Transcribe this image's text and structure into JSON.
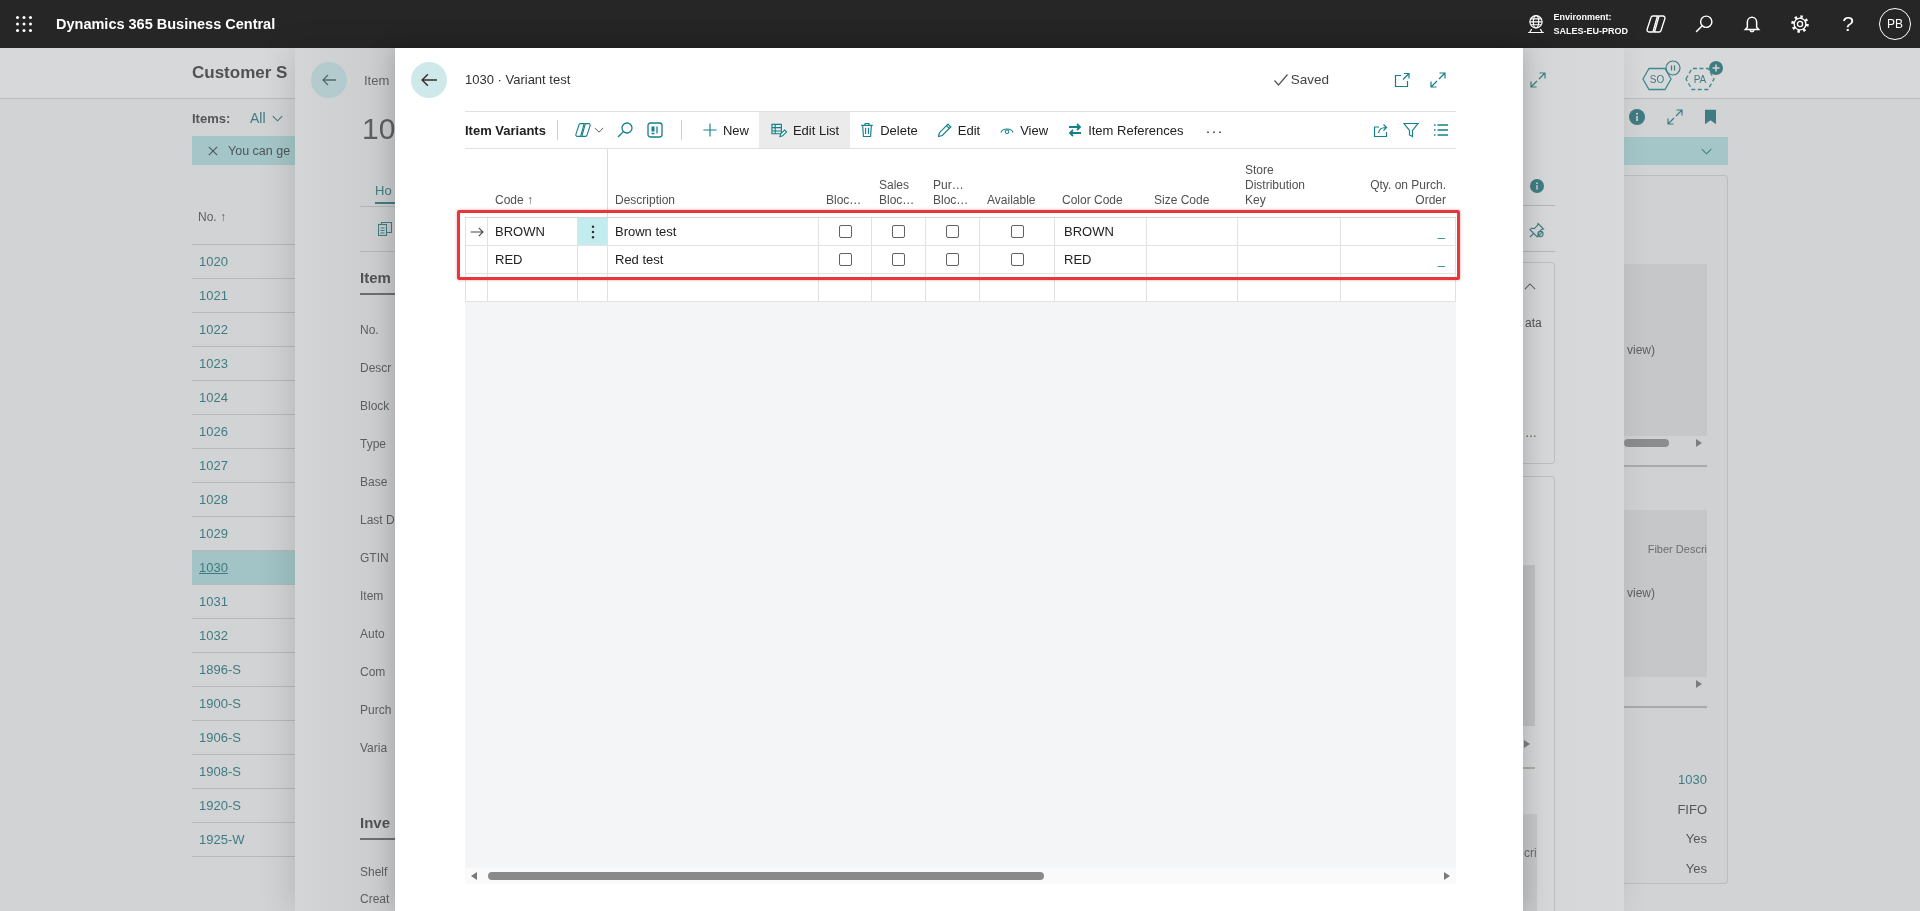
{
  "top_bar": {
    "app_title": "Dynamics 365 Business Central",
    "environment_label": "Environment:",
    "environment_name": "SALES-EU-PROD",
    "help_glyph": "?",
    "avatar_initials": "PB"
  },
  "list_page": {
    "title": "Customer S",
    "filter_label": "Items:",
    "filter_value": "All",
    "banner_text": "You can ge",
    "column_header": "No. ↑",
    "rows": [
      {
        "no": "1020",
        "selected": false
      },
      {
        "no": "1021",
        "selected": false
      },
      {
        "no": "1022",
        "selected": false
      },
      {
        "no": "1023",
        "selected": false
      },
      {
        "no": "1024",
        "selected": false
      },
      {
        "no": "1026",
        "selected": false
      },
      {
        "no": "1027",
        "selected": false
      },
      {
        "no": "1028",
        "selected": false
      },
      {
        "no": "1029",
        "selected": false
      },
      {
        "no": "1030",
        "selected": true
      },
      {
        "no": "1031",
        "selected": false
      },
      {
        "no": "1032",
        "selected": false
      },
      {
        "no": "1896-S",
        "selected": false
      },
      {
        "no": "1900-S",
        "selected": false
      },
      {
        "no": "1906-S",
        "selected": false
      },
      {
        "no": "1908-S",
        "selected": false
      },
      {
        "no": "1920-S",
        "selected": false
      },
      {
        "no": "1925-W",
        "selected": false
      }
    ],
    "badges": [
      {
        "label": "SO",
        "kind": "paused"
      },
      {
        "label": "PA",
        "kind": "add"
      }
    ],
    "factbox": {
      "preview_text_1": "view)",
      "field_caption": "Fiber Descri",
      "preview_text_2": "view)",
      "values": [
        {
          "text": "1030",
          "kind": "link"
        },
        {
          "text": "FIFO",
          "kind": "text"
        },
        {
          "text": "Yes",
          "kind": "text"
        },
        {
          "text": "Yes",
          "kind": "text"
        }
      ]
    }
  },
  "item_card": {
    "breadcrumb": "Item",
    "number": "10",
    "tab": "Ho",
    "section_1": "Item",
    "fields": [
      "No.",
      "Descr",
      "Block",
      "Type",
      "Base",
      "Last D",
      "GTIN",
      "Item",
      "Auto",
      "Com",
      "Purch",
      "Varia"
    ],
    "section_2": "Inve",
    "fields_2": [
      "Shelf",
      "Creat"
    ],
    "factbox_text": "ata",
    "factbox_more": "…",
    "factbox_caption": "cri"
  },
  "dialog": {
    "title": "1030 · Variant test",
    "status": "Saved",
    "page_title": "Item Variants",
    "actions": [
      {
        "kind": "new",
        "label": "New",
        "selected": false
      },
      {
        "kind": "edit_list",
        "label": "Edit List",
        "selected": true
      },
      {
        "kind": "delete",
        "label": "Delete",
        "selected": false
      },
      {
        "kind": "edit",
        "label": "Edit",
        "selected": false
      },
      {
        "kind": "view",
        "label": "View",
        "selected": false
      },
      {
        "kind": "references",
        "label": "Item References",
        "selected": false
      }
    ],
    "more_glyph": "···",
    "table": {
      "columns": [
        "Code ↑",
        "Description",
        "Bloc…",
        "Sales Bloc…",
        "Pur… Bloc…",
        "Available",
        "Color Code",
        "Size Code",
        "Store Distribution Key",
        "Qty. on Purch. Order"
      ],
      "rows": [
        {
          "current": true,
          "code": "BROWN",
          "description": "Brown test",
          "blocked": false,
          "sales_blocked": false,
          "purch_blocked": false,
          "available": false,
          "color_code": "BROWN",
          "qty_on_purch_order": "_"
        },
        {
          "current": false,
          "code": "RED",
          "description": "Red test",
          "blocked": false,
          "sales_blocked": false,
          "purch_blocked": false,
          "available": false,
          "color_code": "RED",
          "qty_on_purch_order": "_"
        }
      ]
    }
  }
}
